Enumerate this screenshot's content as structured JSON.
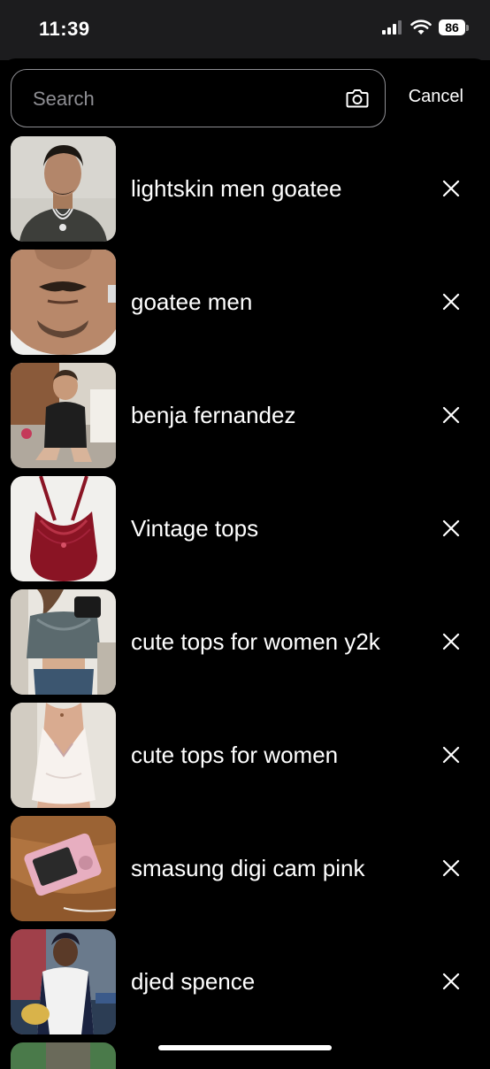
{
  "status_bar": {
    "time": "11:39",
    "battery": "86",
    "icons": [
      "signal-icon",
      "wifi-icon",
      "battery-icon"
    ]
  },
  "search": {
    "placeholder": "Search",
    "value": "",
    "camera_icon": "camera-icon",
    "cancel_label": "Cancel"
  },
  "recent_searches": [
    {
      "label": "lightskin men goatee",
      "thumbnail": "man-portrait",
      "remove_icon": "close-icon"
    },
    {
      "label": "goatee men",
      "thumbnail": "face-closeup",
      "remove_icon": "close-icon"
    },
    {
      "label": "benja fernandez",
      "thumbnail": "toddler-photo",
      "remove_icon": "close-icon"
    },
    {
      "label": "Vintage tops",
      "thumbnail": "red-halter-top",
      "remove_icon": "close-icon"
    },
    {
      "label": "cute tops for women y2k",
      "thumbnail": "mirror-selfie",
      "remove_icon": "close-icon"
    },
    {
      "label": "cute tops for women",
      "thumbnail": "white-halter-top",
      "remove_icon": "close-icon"
    },
    {
      "label": "smasung digi cam pink",
      "thumbnail": "pink-camera",
      "remove_icon": "close-icon"
    },
    {
      "label": "djed spence",
      "thumbnail": "footballer-trophy",
      "remove_icon": "close-icon"
    }
  ],
  "colors": {
    "background": "#000000",
    "status_bar": "#1c1c1e",
    "border": "#8e8e93",
    "text": "#ffffff"
  }
}
